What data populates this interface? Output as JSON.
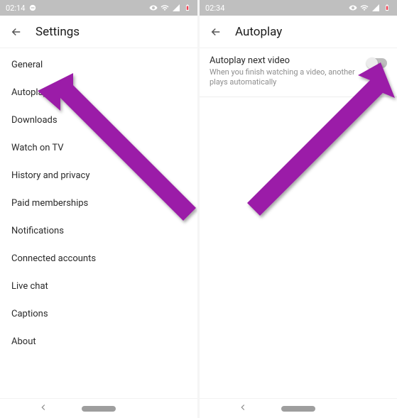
{
  "left": {
    "status": {
      "time": "02:14"
    },
    "title": "Settings",
    "items": [
      "General",
      "Autoplay",
      "Downloads",
      "Watch on TV",
      "History and privacy",
      "Paid memberships",
      "Notifications",
      "Connected accounts",
      "Live chat",
      "Captions",
      "About"
    ]
  },
  "right": {
    "status": {
      "time": "02:34"
    },
    "title": "Autoplay",
    "setting": {
      "title": "Autoplay next video",
      "desc": "When you finish watching a video, another plays automatically"
    }
  },
  "accent": "#9b1fa8"
}
